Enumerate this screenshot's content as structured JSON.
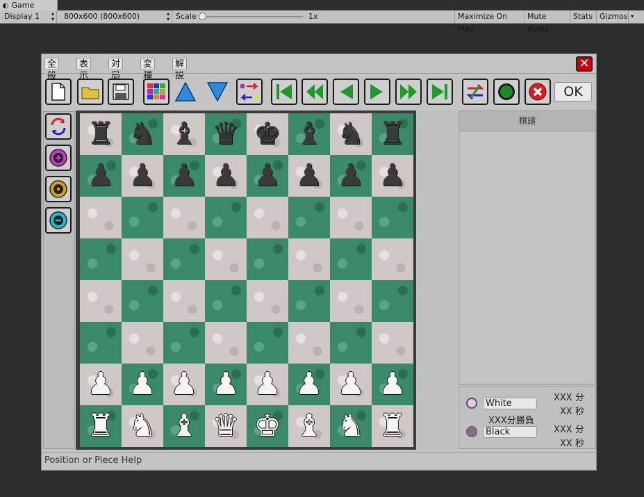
{
  "editor": {
    "tab_title": "Game",
    "display_select": "Display 1",
    "resolution_select": "800x600 (800x600)",
    "scale_label": "Scale",
    "scale_value": "1x",
    "maximize_label": "Maximize On Play",
    "mute_label": "Mute Audio",
    "stats_label": "Stats",
    "gizmos_label": "Gizmos"
  },
  "menu": [
    "全般",
    "表示",
    "対局",
    "変種",
    "解説"
  ],
  "toolbar": {
    "ok_label": "OK",
    "icons": [
      "new-file-icon",
      "open-folder-icon",
      "save-icon",
      "palette-icon",
      "up-arrow-icon",
      "down-arrow-icon",
      "swap-icon",
      "first-move-icon",
      "fast-back-icon",
      "step-back-icon",
      "step-forward-icon",
      "fast-forward-icon",
      "last-move-icon",
      "flip-arrows-icon",
      "record-icon",
      "cancel-icon"
    ]
  },
  "side_tools": [
    "rotate-board-icon",
    "add-icon",
    "center-icon",
    "remove-icon"
  ],
  "board": {
    "rows": [
      [
        "♜",
        "♞",
        "♝",
        "♛",
        "♚",
        "♝",
        "♞",
        "♜"
      ],
      [
        "♟",
        "♟",
        "♟",
        "♟",
        "♟",
        "♟",
        "♟",
        "♟"
      ],
      [
        "",
        "",
        "",
        "",
        "",
        "",
        "",
        ""
      ],
      [
        "",
        "",
        "",
        "",
        "",
        "",
        "",
        ""
      ],
      [
        "",
        "",
        "",
        "",
        "",
        "",
        "",
        ""
      ],
      [
        "",
        "",
        "",
        "",
        "",
        "",
        "",
        ""
      ],
      [
        "♟",
        "♟",
        "♟",
        "♟",
        "♟",
        "♟",
        "♟",
        "♟"
      ],
      [
        "♜",
        "♞",
        "♝",
        "♛",
        "♚",
        "♝",
        "♞",
        "♜"
      ]
    ],
    "colors": [
      "b",
      "b",
      "",
      "",
      "",
      "",
      "w",
      "w"
    ],
    "light_color": "#cfc8c6",
    "dark_color": "#3a8a6a"
  },
  "kifu": {
    "title": "棋譜"
  },
  "players": {
    "white_name": "White",
    "black_name": "Black",
    "white_dot": "#e9c6ea",
    "black_dot": "#8a6b87",
    "white_min": "XXX 分",
    "white_sec": "XX 秒",
    "match_label": "XXX分勝負",
    "black_min": "XXX 分",
    "black_sec": "XX 秒"
  },
  "status": "Position or Piece Help"
}
